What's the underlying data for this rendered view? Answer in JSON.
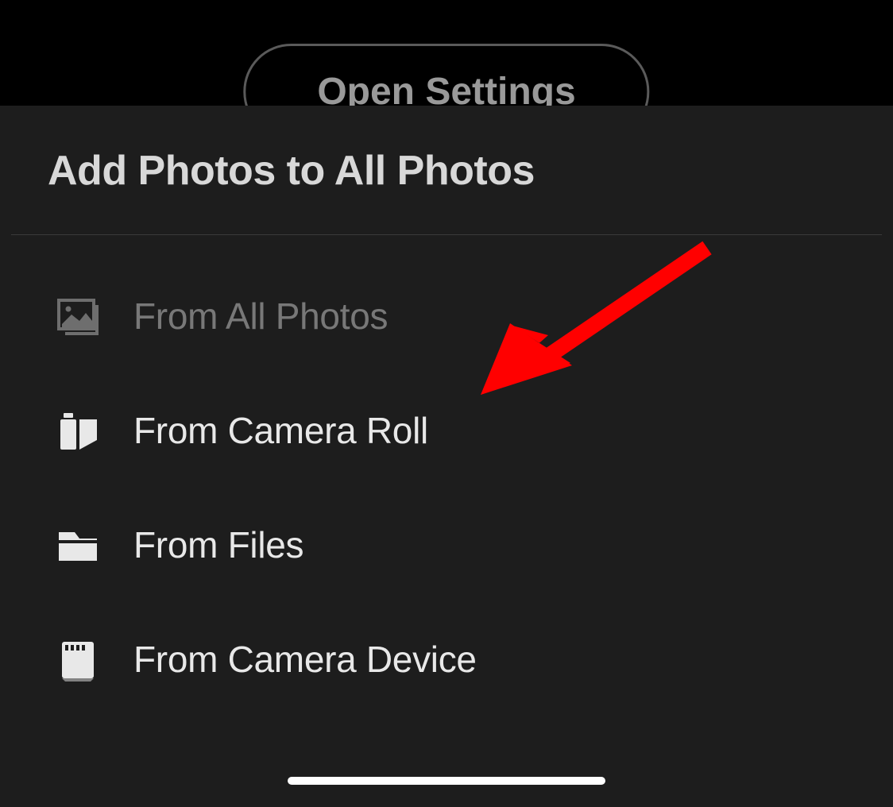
{
  "background": {
    "button_label": "Open Settings"
  },
  "sheet": {
    "title": "Add Photos to All Photos",
    "options": [
      {
        "label": "From All Photos",
        "icon": "all-photos",
        "disabled": true
      },
      {
        "label": "From Camera Roll",
        "icon": "camera-roll",
        "disabled": false
      },
      {
        "label": "From Files",
        "icon": "files",
        "disabled": false
      },
      {
        "label": "From Camera Device",
        "icon": "camera-device",
        "disabled": false
      }
    ]
  }
}
